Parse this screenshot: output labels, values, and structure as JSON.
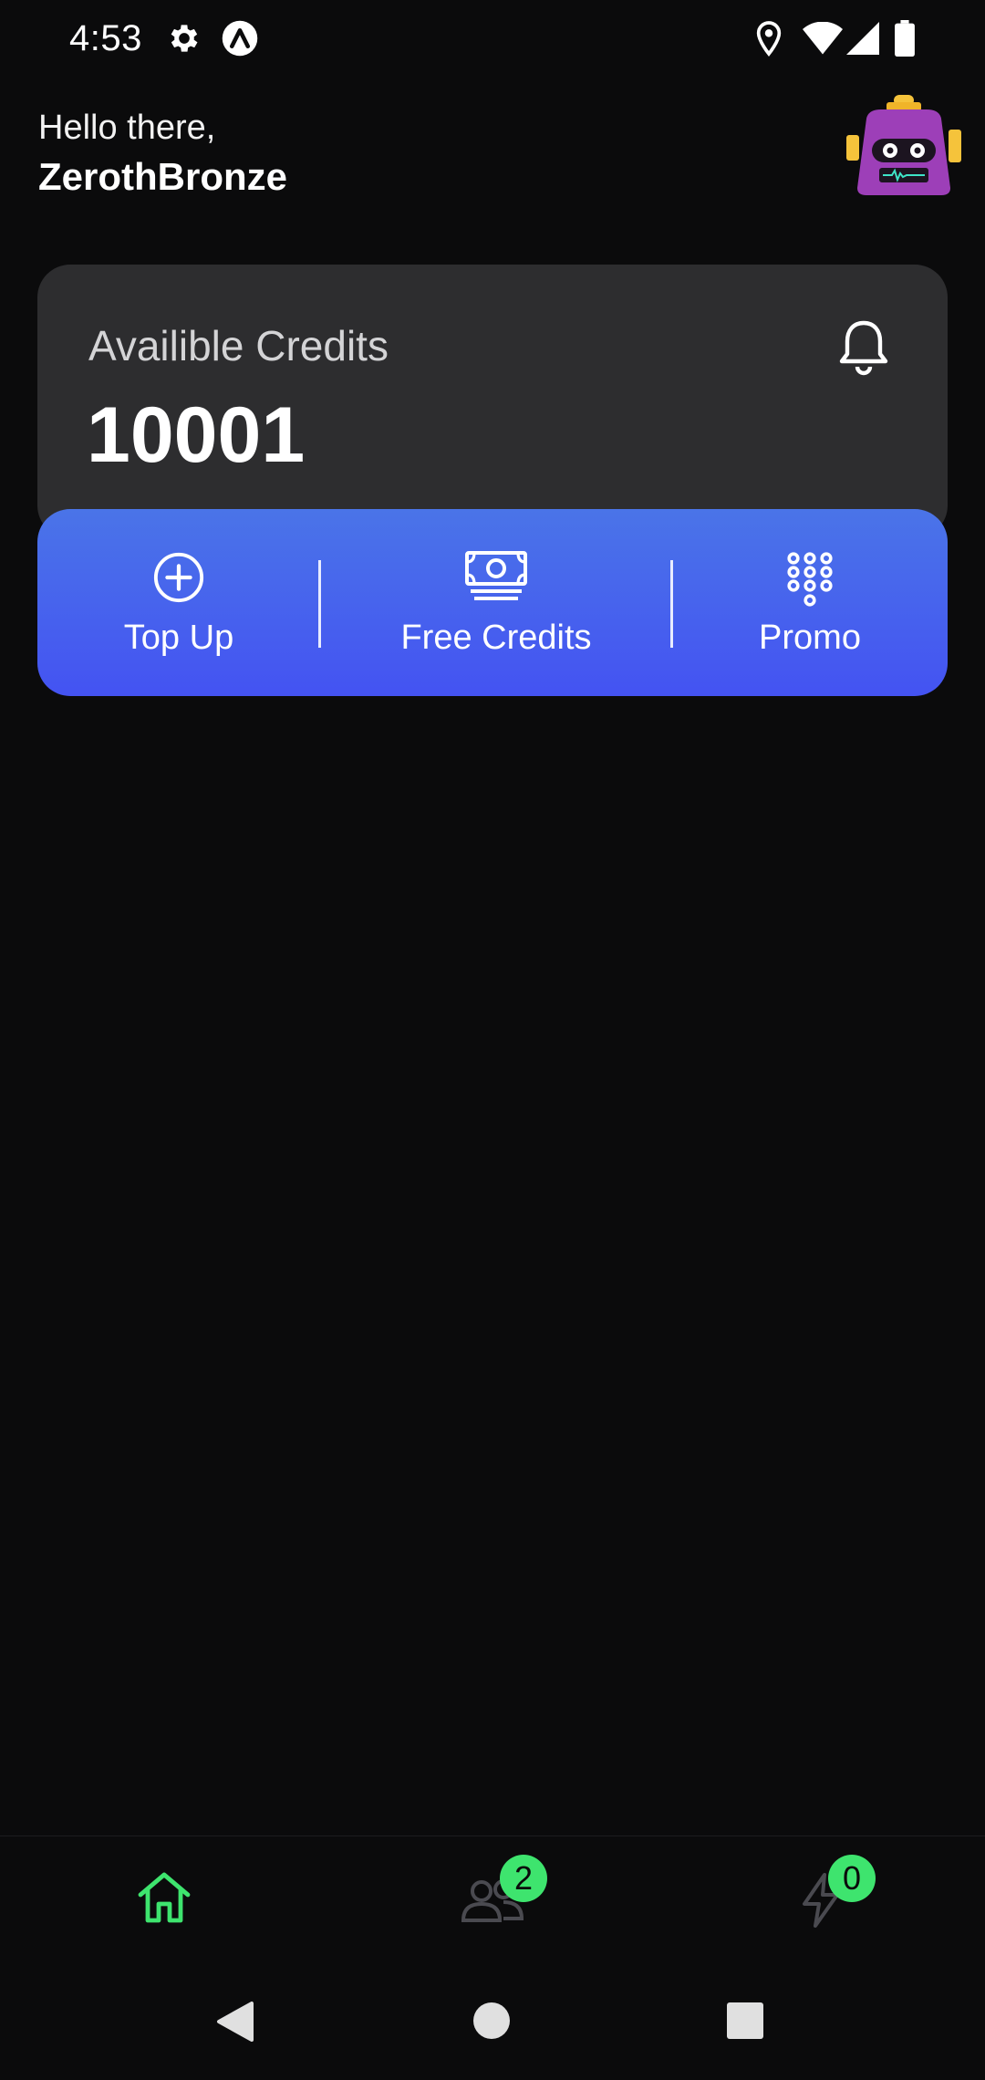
{
  "status_bar": {
    "time": "4:53"
  },
  "greeting": {
    "line1": "Hello there,",
    "username": "ZerothBronze"
  },
  "credits": {
    "label": "Availible Credits",
    "value": "10001"
  },
  "actions": [
    {
      "label": "Top Up",
      "icon": "plus-circle-icon"
    },
    {
      "label": "Free Credits",
      "icon": "cash-icon"
    },
    {
      "label": "Promo",
      "icon": "dial-pad-icon"
    }
  ],
  "bottom_nav": {
    "items": [
      {
        "icon": "home-icon",
        "active": true
      },
      {
        "icon": "people-icon",
        "badge": "2"
      },
      {
        "icon": "lightning-icon",
        "badge": "0"
      }
    ]
  },
  "colors": {
    "background": "#0b0b0c",
    "card": "#2d2d2f",
    "accent_gradient_top": "#4a74e8",
    "accent_gradient_bottom": "#4453f2",
    "active_nav": "#3ee46e",
    "badge": "#3ee46e"
  }
}
